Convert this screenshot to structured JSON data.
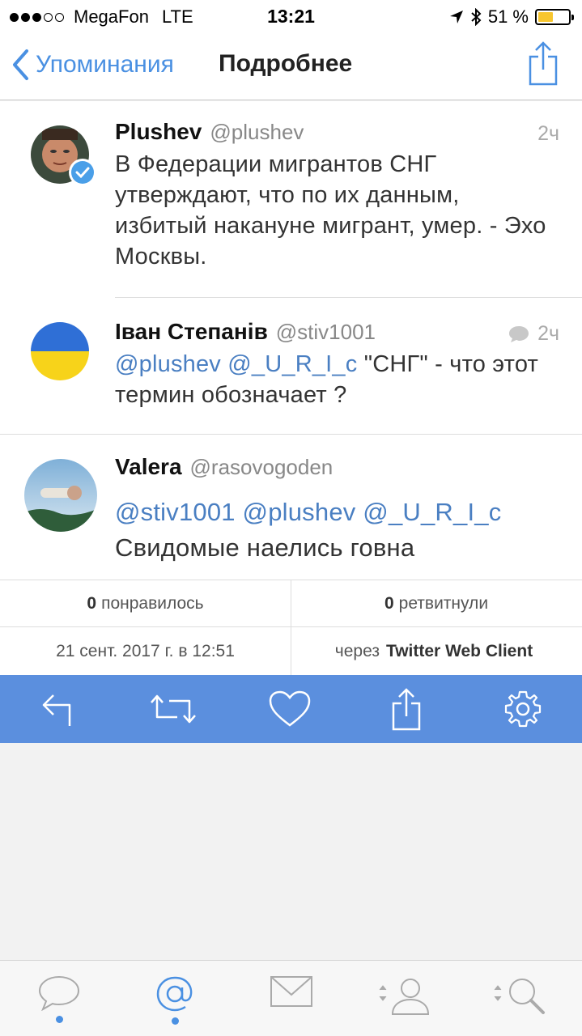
{
  "status_bar": {
    "carrier": "MegaFon",
    "network": "LTE",
    "time": "13:21",
    "battery": "51 %",
    "battery_level": 0.51
  },
  "nav": {
    "back_label": "Упоминания",
    "title": "Подробнее"
  },
  "tweets": [
    {
      "name": "Plushev",
      "handle": "@plushev",
      "time": "2ч",
      "text": "В Федерации мигрантов СНГ утверждают, что по их данным, избитый накануне мигрант, умер. - Эхо Москвы."
    },
    {
      "name": "Іван Степанів",
      "handle": "@stiv1001",
      "time": "2ч",
      "mentions": "@plushev @_U_R_I_c",
      "text": " \"СНГ\" - что этот термин обозначает ?"
    },
    {
      "name": "Valera",
      "handle": "@rasovogoden",
      "mentions": "@stiv1001 @plushev @_U_R_I_c",
      "text": "Свидомые наелись говна"
    }
  ],
  "stats": {
    "likes_count": "0",
    "likes_label": "понравилось",
    "retweets_count": "0",
    "retweets_label": "ретвитнули",
    "date": "21 сент. 2017 г. в 12:51",
    "via_label": "через",
    "client": "Twitter Web Client"
  },
  "colors": {
    "accent": "#4a90e2",
    "action_bar": "#5b8fde",
    "mention": "#4a7fc2"
  },
  "icons": {
    "action_bar": [
      "reply-icon",
      "retweet-icon",
      "heart-icon",
      "share-icon",
      "gear-icon"
    ],
    "tab_bar": [
      "timeline-icon",
      "mentions-icon",
      "messages-icon",
      "profile-icon",
      "search-icon"
    ]
  }
}
